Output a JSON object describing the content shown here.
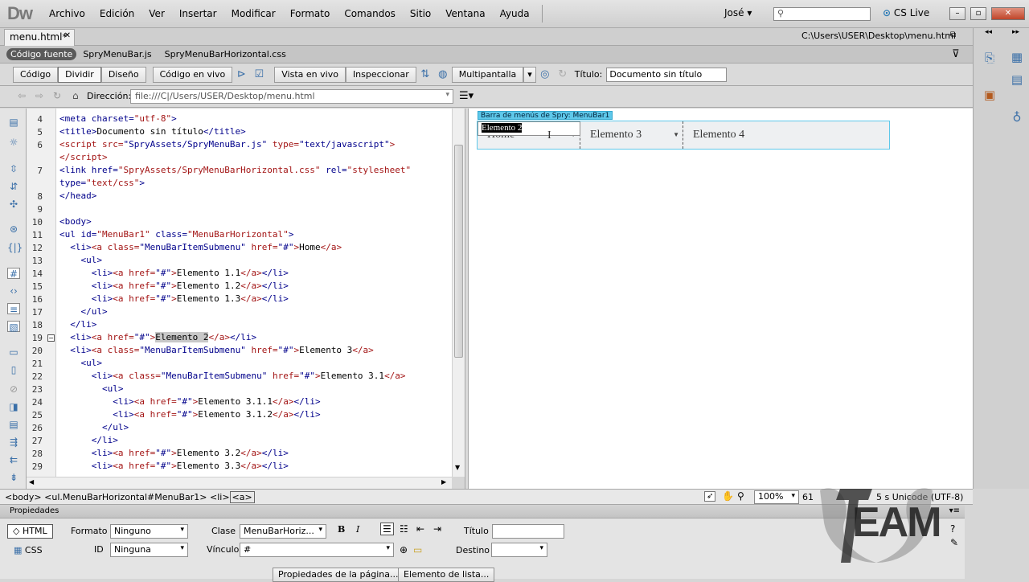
{
  "app": {
    "logo": "Dw",
    "menu": [
      "Archivo",
      "Edición",
      "Ver",
      "Insertar",
      "Modificar",
      "Formato",
      "Comandos",
      "Sitio",
      "Ventana",
      "Ayuda"
    ],
    "user": "José ▾",
    "cslive": "CS Live"
  },
  "document": {
    "tab": "menu.html*",
    "path": "C:\\Users\\USER\\Desktop\\menu.html",
    "related_files": [
      "Código fuente",
      "SpryMenuBar.js",
      "SpryMenuBarHorizontal.css"
    ]
  },
  "toolbar": {
    "code": "Código",
    "split": "Dividir",
    "design": "Diseño",
    "live_code": "Código en vivo",
    "live_view": "Vista en vivo",
    "inspect": "Inspeccionar",
    "multiscreen": "Multipantalla",
    "title_label": "Título:",
    "title_value": "Documento sin título"
  },
  "address": {
    "label": "Dirección:",
    "value": "file:///C|/Users/USER/Desktop/menu.html"
  },
  "code": {
    "line_numbers": [
      "4",
      "5",
      "6",
      "",
      "7",
      "",
      "8",
      "9",
      "10",
      "11",
      "12",
      "13",
      "14",
      "15",
      "16",
      "17",
      "18",
      "19",
      "20",
      "21",
      "22",
      "23",
      "24",
      "25",
      "26",
      "27",
      "28",
      "29"
    ]
  },
  "design": {
    "spry_label": "Barra de menús de Spry: MenuBar1",
    "items": [
      "Home",
      "Elemento 2",
      "Elemento 3",
      "Elemento 4"
    ]
  },
  "tag_selector": {
    "crumbs": "<body> <ul.MenuBarHorizontal#MenuBar1> <li>",
    "current": "<a>",
    "zoom": "100%",
    "status": "5 s  Unicode (UTF-8)",
    "status_left": "61"
  },
  "properties": {
    "title": "Propiedades",
    "html": "HTML",
    "css": "CSS",
    "format_label": "Formato",
    "format_value": "Ninguno",
    "id_label": "ID",
    "id_value": "Ninguna",
    "class_label": "Clase",
    "class_value": "MenuBarHoriz...",
    "link_label": "Vínculo",
    "link_value": "#",
    "title_label": "Título",
    "target_label": "Destino",
    "page_props": "Propiedades de la página...",
    "list_item": "Elemento de lista..."
  },
  "watermark": "EAM"
}
